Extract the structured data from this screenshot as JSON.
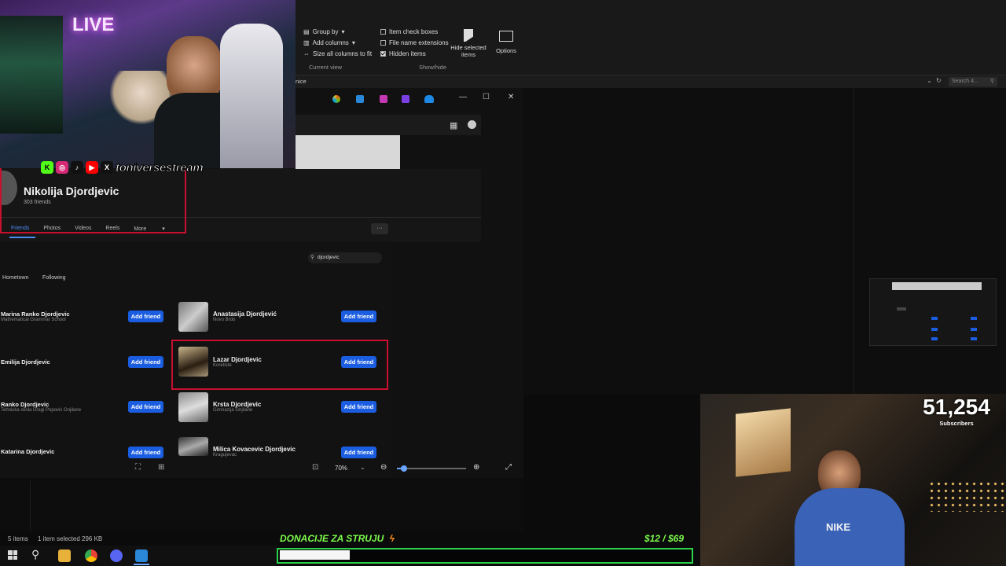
{
  "explorer": {
    "ribbon": {
      "layout": {
        "group_by": "Group by",
        "add_columns": "Add columns",
        "size_columns": "Size all columns to fit",
        "group_label": "Current view"
      },
      "show_hide": {
        "item_check_boxes": "Item check boxes",
        "file_name_extensions": "File name extensions",
        "hidden_items": "Hidden items",
        "hide_selected": "Hide selected items",
        "options": "Options",
        "group_label": "Show/hide"
      }
    },
    "address_fragment": "nice",
    "search_placeholder": "Search 4...",
    "status": {
      "items": "5 items",
      "selected": "1 item selected  296 KB"
    }
  },
  "profile": {
    "name": "Nikolija Djordjevic",
    "friends_count": "303 friends",
    "tabs": [
      "Friends",
      "Photos",
      "Videos",
      "Reels",
      "More"
    ],
    "more_menu": "···"
  },
  "friends_panel": {
    "search_value": "djordjevic",
    "filters": [
      "Hometown",
      "Following"
    ],
    "add_label": "Add friend",
    "left_column": [
      {
        "name": "Marina Ranko Djordjevic",
        "sub": "Mathematical Grammar School"
      },
      {
        "name": "Emilija Djordjevic",
        "sub": ""
      },
      {
        "name": "Ranko Djordjevic",
        "sub": "Tehnicka skola Dragi Popovic Gnjilane"
      },
      {
        "name": "Katarina Djordjevic",
        "sub": ""
      }
    ],
    "right_column": [
      {
        "name": "Anastasija Djordjević",
        "sub": "Novo Brdo"
      },
      {
        "name": "Lazar Djordjevic",
        "sub": "Koretiste"
      },
      {
        "name": "Krsta Djordjevic",
        "sub": "Gimnazija Gnjilane"
      },
      {
        "name": "Milica Kovacevic Djordjevic",
        "sub": "Kragujevac"
      }
    ]
  },
  "viewer": {
    "zoom": "70%",
    "zoom_level": 0.1
  },
  "stream": {
    "live_sign": "LIVE",
    "handle": "toniversestream",
    "social_letters": [
      "K",
      "◎",
      "♪",
      "▶",
      "X"
    ],
    "subscribers_count": "51,254",
    "subscribers_label": "Subscribers",
    "donation_title": "DONACIJE ZA STRUJU",
    "donation_amount": "$12  / $69",
    "donation_progress": 0.17,
    "shirt_text": "NIKE"
  },
  "colors": {
    "accent_blue": "#1b5de0",
    "highlight_red": "#c8102e",
    "donation_green": "#2bd24a",
    "donation_text": "#7CFC4C"
  }
}
